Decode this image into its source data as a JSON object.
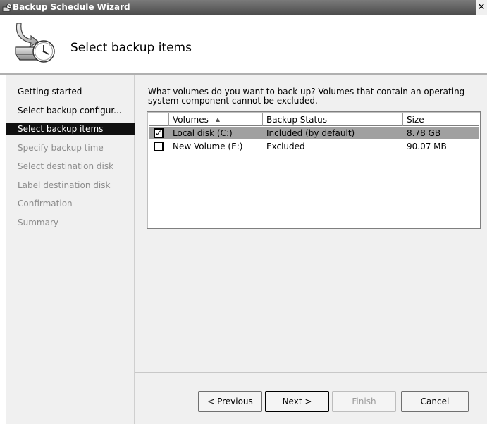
{
  "window": {
    "title": "Backup Schedule Wizard",
    "close_glyph": "✕"
  },
  "header": {
    "title": "Select backup items",
    "icon": "backup-disk-clock-icon"
  },
  "nav": {
    "items": [
      {
        "label": "Getting started",
        "state": "done"
      },
      {
        "label": "Select backup configur...",
        "state": "done"
      },
      {
        "label": "Select backup items",
        "state": "active"
      },
      {
        "label": "Specify backup time",
        "state": "disabled"
      },
      {
        "label": "Select destination disk",
        "state": "disabled"
      },
      {
        "label": "Label destination disk",
        "state": "disabled"
      },
      {
        "label": "Confirmation",
        "state": "disabled"
      },
      {
        "label": "Summary",
        "state": "disabled"
      }
    ]
  },
  "content": {
    "question": "What volumes do you want to back up? Volumes that contain an operating system component cannot be excluded.",
    "table": {
      "columns": [
        "Volumes",
        "Backup Status",
        "Size"
      ],
      "sort_column": "Volumes",
      "sort_direction": "ascending",
      "rows": [
        {
          "checked": true,
          "volume": "Local disk (C:)",
          "status": "Included (by default)",
          "size": "8.78 GB",
          "selected": true
        },
        {
          "checked": false,
          "volume": "New Volume (E:)",
          "status": "Excluded",
          "size": "90.07 MB",
          "selected": false
        }
      ]
    }
  },
  "buttons": {
    "previous": "< Previous",
    "next": "Next >",
    "finish": "Finish",
    "cancel": "Cancel"
  },
  "colors": {
    "selection": "#a0a0a0",
    "active_nav": "#101010",
    "pane_bg": "#f0f0f0"
  }
}
